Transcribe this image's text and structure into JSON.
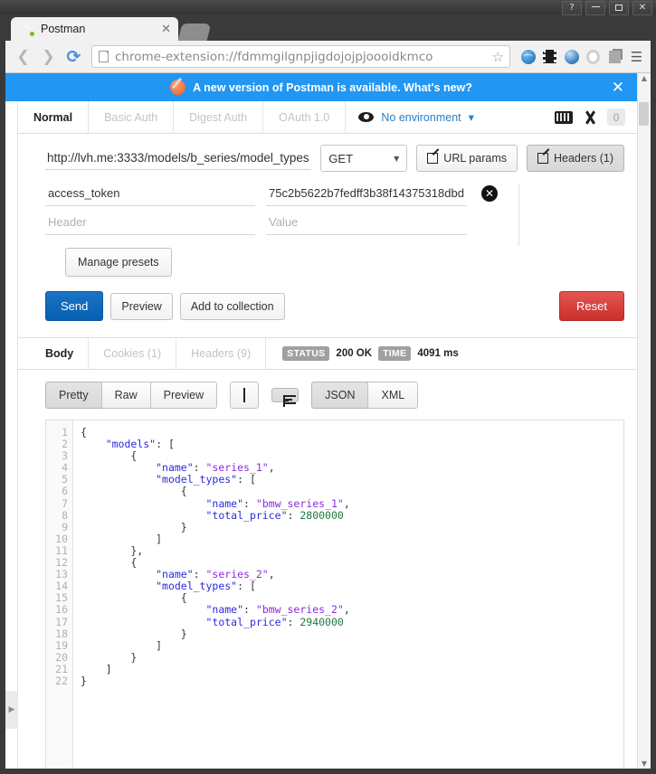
{
  "window": {
    "controls": [
      {
        "name": "help",
        "glyph": "?"
      },
      {
        "name": "minimize",
        "glyph": ""
      },
      {
        "name": "maximize",
        "glyph": ""
      },
      {
        "name": "close",
        "glyph": "✕"
      }
    ]
  },
  "browser": {
    "tab_title": "Postman",
    "tab_close_glyph": "✕",
    "url": "chrome-extension://fdmmgilgnpjigdojojpjoooidkmco",
    "back_glyph": "❮",
    "forward_glyph": "❯",
    "reload_glyph": "⟳",
    "star_glyph": "☆",
    "menu_glyph": "☰"
  },
  "notification": {
    "text": "A new version of Postman is available. What's new?",
    "close_glyph": "✕",
    "background": "#2196f3"
  },
  "auth": {
    "tabs": [
      {
        "label": "Normal",
        "active": true
      },
      {
        "label": "Basic Auth",
        "active": false
      },
      {
        "label": "Digest Auth",
        "active": false
      },
      {
        "label": "OAuth 1.0",
        "active": false
      }
    ],
    "environment": "No environment",
    "environment_caret": "▾",
    "badge_count": "0"
  },
  "request": {
    "url": "http://lvh.me:3333/models/b_series/model_types",
    "method": "GET",
    "method_caret": "▼",
    "url_params_label": "URL params",
    "headers_label": "Headers (1)"
  },
  "headers": {
    "rows": [
      {
        "key": "access_token",
        "value": "75c2b5622b7fedff3b38f14375318dbd",
        "delete_glyph": "✕"
      }
    ],
    "key_placeholder": "Header",
    "value_placeholder": "Value",
    "manage_presets_label": "Manage presets"
  },
  "actions": {
    "send_label": "Send",
    "preview_label": "Preview",
    "add_to_collection_label": "Add to collection",
    "reset_label": "Reset",
    "send_color": "#0a5fb0",
    "reset_color": "#c9302c"
  },
  "response": {
    "tabs": [
      {
        "label": "Body",
        "active": true
      },
      {
        "label": "Cookies (1)",
        "active": false
      },
      {
        "label": "Headers (9)",
        "active": false
      }
    ],
    "status_label": "STATUS",
    "status_value": "200 OK",
    "time_label": "TIME",
    "time_value": "4091 ms"
  },
  "format": {
    "view_modes": [
      {
        "label": "Pretty",
        "active": true
      },
      {
        "label": "Raw",
        "active": false
      },
      {
        "label": "Preview",
        "active": false
      }
    ],
    "languages": [
      {
        "label": "JSON",
        "active": true
      },
      {
        "label": "XML",
        "active": false
      }
    ]
  },
  "code": {
    "line_numbers": [
      "1",
      "2",
      "3",
      "4",
      "5",
      "6",
      "7",
      "8",
      "9",
      "10",
      "11",
      "12",
      "13",
      "14",
      "15",
      "16",
      "17",
      "18",
      "19",
      "20",
      "21",
      "22"
    ],
    "lines": [
      "{",
      "    \"models\": [",
      "        {",
      "            \"name\": \"series_1\",",
      "            \"model_types\": [",
      "                {",
      "                    \"name\": \"bmw_series_1\",",
      "                    \"total_price\": 2800000",
      "                }",
      "            ]",
      "        },",
      "        {",
      "            \"name\": \"series_2\",",
      "            \"model_types\": [",
      "                {",
      "                    \"name\": \"bmw_series_2\",",
      "                    \"total_price\": 2940000",
      "                }",
      "            ]",
      "        }",
      "    ]",
      "}"
    ]
  },
  "sidebar": {
    "toggle_glyph": "▶"
  },
  "scrollbar": {
    "up_glyph": "▲",
    "down_glyph": "▼"
  }
}
